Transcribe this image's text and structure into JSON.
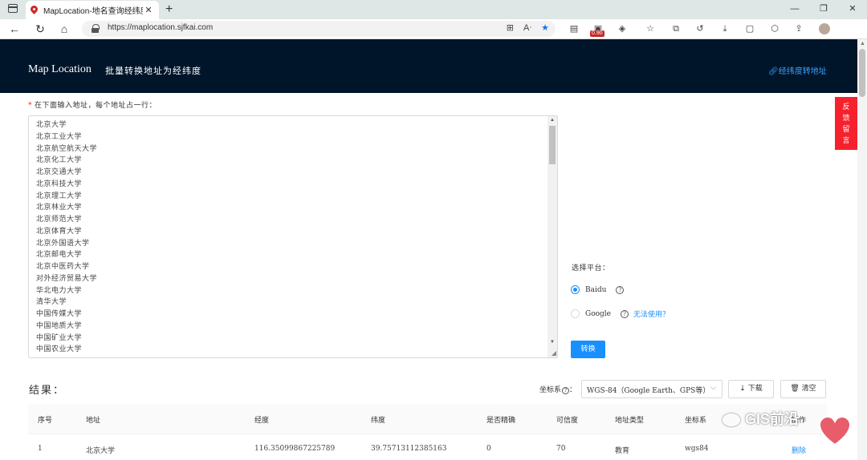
{
  "browser": {
    "tab_title": "MapLocation-地名查询经纬度|地",
    "tab_close": "✕",
    "new_tab": "+",
    "url": "https://maplocation.sjfkai.com",
    "ext_badge": "0.90"
  },
  "header": {
    "brand": "Map Location",
    "subtitle": "批量转换地址为经纬度",
    "right_link": "经纬度转地址"
  },
  "feedback": {
    "label": "反馈留言"
  },
  "form": {
    "input_label": "在下面输入地址，每个地址占一行：",
    "addresses": [
      "北京大学",
      "北京工业大学",
      "北京航空航天大学",
      "北京化工大学",
      "北京交通大学",
      "北京科技大学",
      "北京理工大学",
      "北京林业大学",
      "北京师范大学",
      "北京体育大学",
      "北京外国语大学",
      "北京邮电大学",
      "北京中医药大学",
      "对外经济贸易大学",
      "华北电力大学",
      "清华大学",
      "中国传媒大学",
      "中国地质大学",
      "中国矿业大学",
      "中国农业大学"
    ],
    "platform_label": "选择平台：",
    "platform_options": [
      {
        "label": "Baidu",
        "selected": true
      },
      {
        "label": "Google",
        "selected": false
      }
    ],
    "google_help_link": "无法使用？",
    "convert_button": "转换"
  },
  "results": {
    "title": "结果：",
    "crs_label": "坐标系",
    "crs_selected": "WGS-84（Google Earth、GPS等）",
    "download_button": "下载",
    "clear_button": "清空",
    "columns": [
      "序号",
      "地址",
      "经度",
      "纬度",
      "是否精确",
      "可信度",
      "地址类型",
      "坐标系",
      "",
      "操作"
    ],
    "rows": [
      {
        "index": "1",
        "address": "北京大学",
        "lng": "116.35099867225789",
        "lat": "39.75713112385163",
        "precise": "0",
        "confidence": "70",
        "type": "教育",
        "crs": "wgs84",
        "action": "删除"
      }
    ]
  },
  "watermark": {
    "text": "GIS前沿"
  },
  "colors": {
    "header_bg": "#001529",
    "primary": "#1890ff",
    "feedback_bg": "#f5222d"
  }
}
